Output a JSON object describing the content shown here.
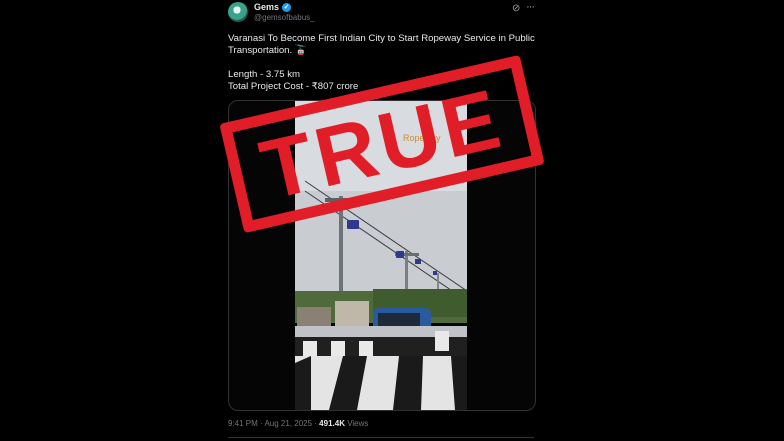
{
  "tweet": {
    "display_name": "Gems",
    "handle": "@gemsofbabus_",
    "text_line1": "Varanasi To Become First Indian City to Start Ropeway Service in Public Transportation. 🚡",
    "text_line2": "Length - 3.75 km",
    "text_line3": "Total Project Cost - ₹807 crore",
    "time": "9:41 PM · Aug 21, 2025 · ",
    "views_count": "491.4K",
    "views_label": " Views"
  },
  "video": {
    "overlay_text": "Ropeway"
  },
  "stamp": {
    "text": "TRUE",
    "color": "#e11d27"
  },
  "icons": [
    "verified-badge-icon",
    "grok-icon",
    "more-options-icon"
  ]
}
